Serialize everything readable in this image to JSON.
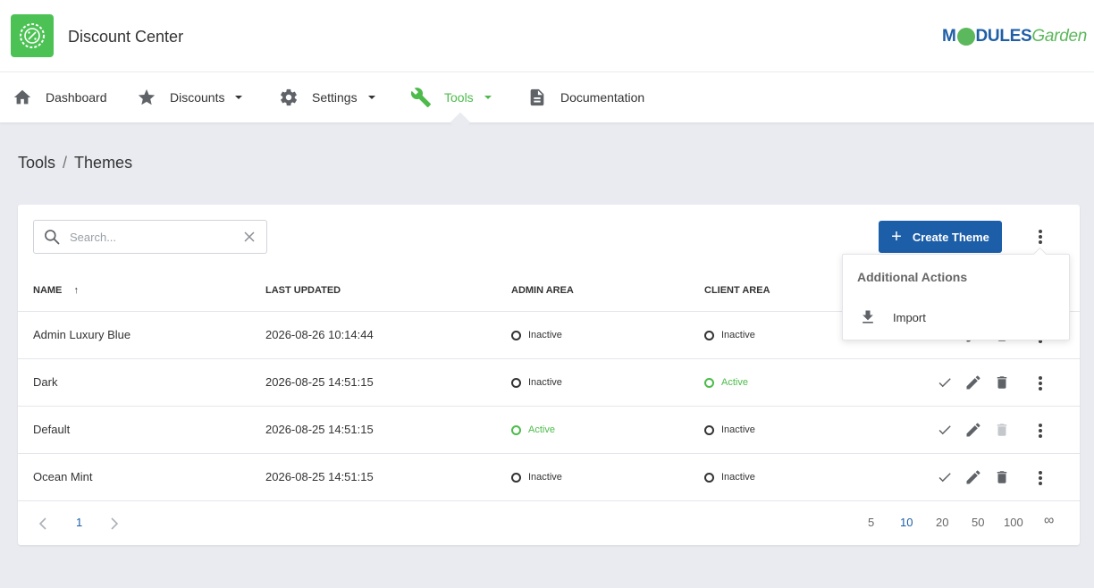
{
  "app": {
    "title": "Discount Center",
    "logo_icon": "discount-badge-icon"
  },
  "brand": {
    "part1": "M",
    "part2": "DULES",
    "part3": "Garden"
  },
  "nav": {
    "items": [
      {
        "label": "Dashboard",
        "icon": "home-icon"
      },
      {
        "label": "Discounts",
        "icon": "star-icon"
      },
      {
        "label": "Settings",
        "icon": "gear-icon"
      },
      {
        "label": "Tools",
        "icon": "wrench-icon"
      },
      {
        "label": "Documentation",
        "icon": "document-icon"
      }
    ],
    "active": "Tools"
  },
  "breadcrumb": {
    "parent": "Tools",
    "separator": "/",
    "current": "Themes"
  },
  "search": {
    "placeholder": "Search..."
  },
  "toolbar": {
    "create_label": "Create Theme"
  },
  "table": {
    "headers": {
      "name": "NAME",
      "updated": "LAST UPDATED",
      "admin": "ADMIN AREA",
      "client": "CLIENT AREA"
    },
    "sort_indicator": "↑",
    "rows": [
      {
        "name": "Admin Luxury Blue",
        "updated": "2026-08-26 10:14:44",
        "admin": "Inactive",
        "client": "Inactive"
      },
      {
        "name": "Dark",
        "updated": "2026-08-25 14:51:15",
        "admin": "Inactive",
        "client": "Active"
      },
      {
        "name": "Default",
        "updated": "2026-08-25 14:51:15",
        "admin": "Active",
        "client": "Inactive"
      },
      {
        "name": "Ocean Mint",
        "updated": "2026-08-25 14:51:15",
        "admin": "Inactive",
        "client": "Inactive"
      }
    ]
  },
  "pagination": {
    "current_page": "1",
    "sizes": [
      "5",
      "10",
      "20",
      "50",
      "100",
      "∞"
    ],
    "selected_size": "10"
  },
  "dropdown": {
    "title": "Additional Actions",
    "items": [
      {
        "label": "Import",
        "icon": "download-icon"
      }
    ]
  },
  "colors": {
    "accent_green": "#4cbb4a",
    "primary_blue": "#1d5ea8",
    "background": "#e9ebf0"
  }
}
